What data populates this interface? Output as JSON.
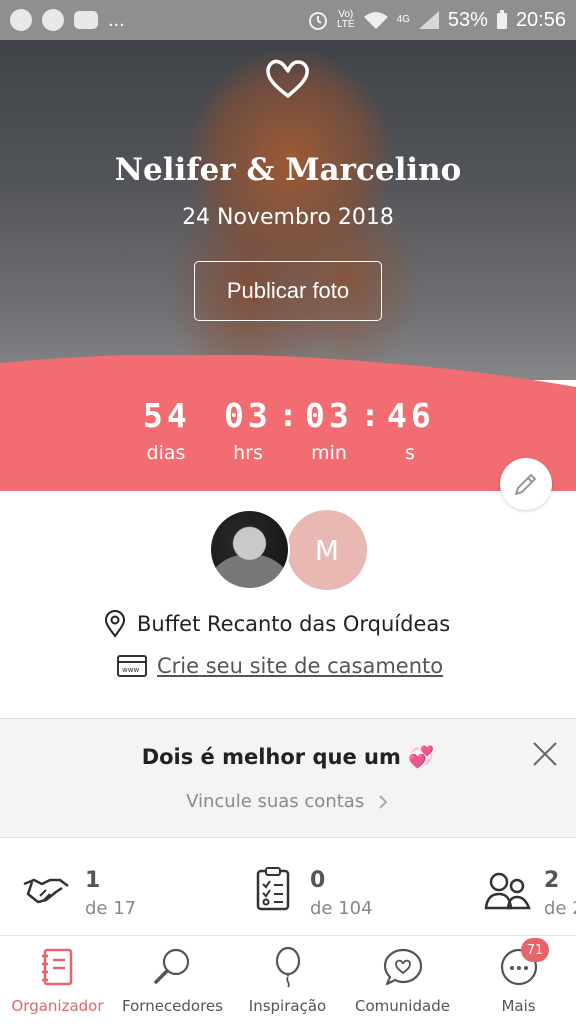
{
  "status_bar": {
    "more": "...",
    "network_top": "Vo)",
    "network_bottom": "LTE",
    "signal_label": "4G",
    "battery": "53%",
    "time": "20:56"
  },
  "hero": {
    "couple": "Nelifer & Marcelino",
    "date": "24 Novembro 2018",
    "publish_button": "Publicar foto"
  },
  "countdown": {
    "days": "54",
    "hours": "03",
    "minutes": "03",
    "seconds": "46",
    "days_label": "dias",
    "hours_label": "hrs",
    "minutes_label": "min",
    "seconds_label": "s",
    "separator": ":"
  },
  "profile": {
    "partner_initial": "M",
    "venue": "Buffet Recanto das Orquídeas",
    "site_link": "Crie seu site de casamento"
  },
  "promo": {
    "title": "Dois é melhor que um 💞",
    "link": "Vincule suas contas"
  },
  "stats": [
    {
      "value": "1",
      "of": "de 17",
      "icon": "handshake-icon"
    },
    {
      "value": "0",
      "of": "de 104",
      "icon": "checklist-icon"
    },
    {
      "value": "2",
      "of": "de 2",
      "icon": "guests-icon"
    }
  ],
  "nav": [
    {
      "label": "Organizador",
      "icon": "notebook-icon",
      "active": true
    },
    {
      "label": "Fornecedores",
      "icon": "search-icon"
    },
    {
      "label": "Inspiração",
      "icon": "balloon-icon"
    },
    {
      "label": "Comunidade",
      "icon": "chat-heart-icon"
    },
    {
      "label": "Mais",
      "icon": "more-icon",
      "badge": "71"
    }
  ],
  "colors": {
    "accent": "#e8636a",
    "countdown_bg": "#f26d72"
  }
}
